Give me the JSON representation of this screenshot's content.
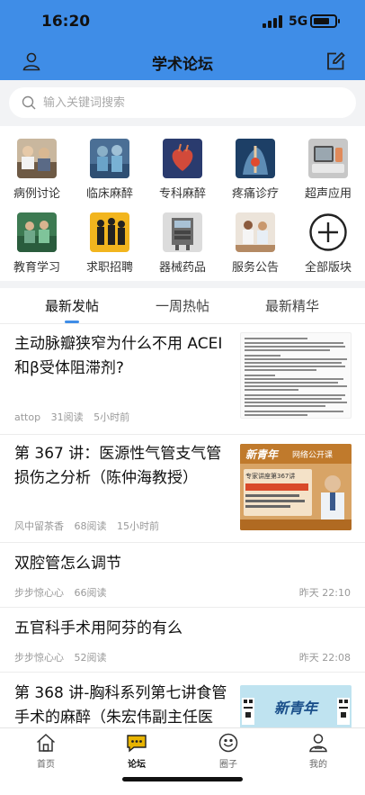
{
  "status_bar": {
    "time": "16:20",
    "network": "5G"
  },
  "header": {
    "title": "学术论坛"
  },
  "search": {
    "placeholder": "输入关键词搜索"
  },
  "categories": [
    {
      "label": "病例讨论"
    },
    {
      "label": "临床麻醉"
    },
    {
      "label": "专科麻醉"
    },
    {
      "label": "疼痛诊疗"
    },
    {
      "label": "超声应用"
    },
    {
      "label": "教育学习"
    },
    {
      "label": "求职招聘"
    },
    {
      "label": "器械药品"
    },
    {
      "label": "服务公告"
    },
    {
      "label": "全部版块"
    }
  ],
  "tabs": [
    {
      "label": "最新发帖",
      "active": true
    },
    {
      "label": "一周热帖",
      "active": false
    },
    {
      "label": "最新精华",
      "active": false
    }
  ],
  "posts": [
    {
      "title_lines": [
        "主动脉瓣狭窄为什么不用 ACEI",
        "和β受体阻滞剂?"
      ],
      "author": "attop",
      "reads": "31阅读",
      "time": "5小时前"
    },
    {
      "title_lines": [
        "第 367 讲：医源性气管支气管",
        "损伤之分析（陈仲海教授）"
      ],
      "author": "风中留茶香",
      "reads": "68阅读",
      "time": "15小时前",
      "image_banner": "新青年",
      "image_banner_sub": "网络公开课",
      "image_heading": "专家讲座第367讲"
    },
    {
      "title_lines": [
        "双腔管怎么调节"
      ],
      "author": "步步惊心心",
      "reads": "66阅读",
      "time": "昨天 22:10"
    },
    {
      "title_lines": [
        "五官科手术用阿芬的有么"
      ],
      "author": "步步惊心心",
      "reads": "52阅读",
      "time": "昨天 22:08"
    },
    {
      "title_lines": [
        "第 368 讲-胸科系列第七讲食管",
        "手术的麻醉（朱宏伟副主任医"
      ],
      "image_banner": "新青年"
    }
  ],
  "bottom_nav": [
    {
      "label": "首页",
      "active": false
    },
    {
      "label": "论坛",
      "active": true
    },
    {
      "label": "圈子",
      "active": false
    },
    {
      "label": "我的",
      "active": false
    }
  ],
  "colors": {
    "accent": "#3f8de7",
    "tab_indicator": "#3f8de7",
    "forum_icon": "#e8b400"
  }
}
